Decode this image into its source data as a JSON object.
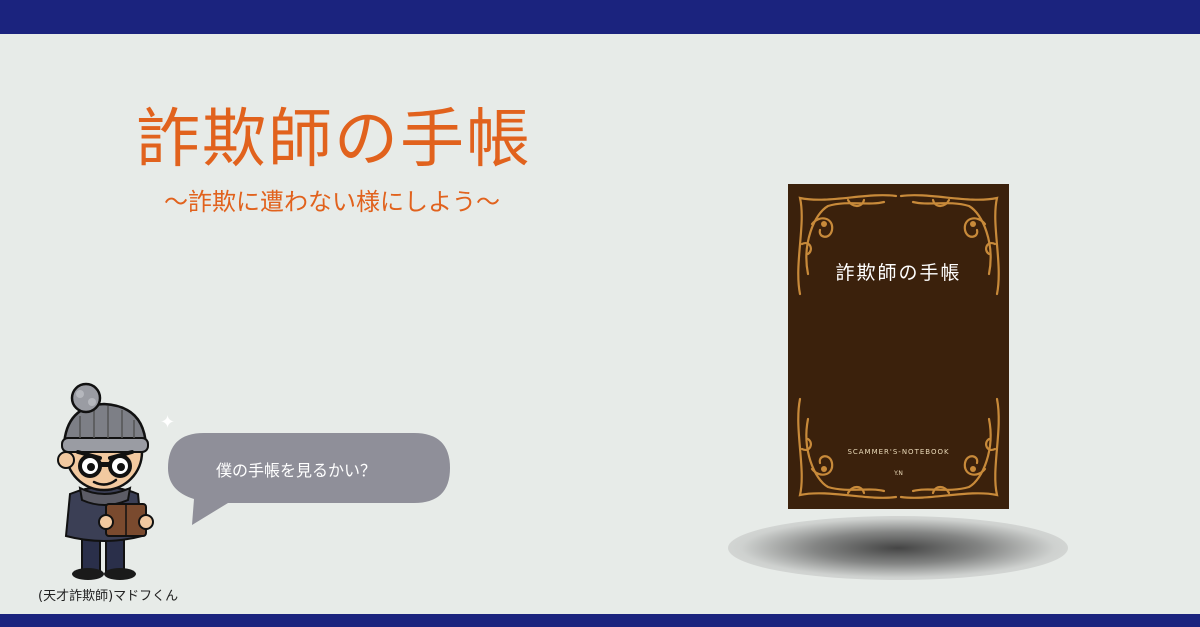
{
  "banner": {
    "title": "詐欺師の手帳",
    "subtitle": "〜詐欺に遭わない様にしよう〜"
  },
  "book": {
    "title": "詐欺師の手帳",
    "subtitle": "SCAMMER'S-NOTEBOOK",
    "author": "Y.N"
  },
  "character": {
    "caption": "(天才詐欺師)マドフくん",
    "speech": "僕の手帳を見るかい？"
  },
  "colors": {
    "accent": "#e1621d",
    "navy": "#1b237e",
    "book": "#3b210c",
    "gold": "#c88a3a",
    "bubble": "#8f8f99"
  }
}
